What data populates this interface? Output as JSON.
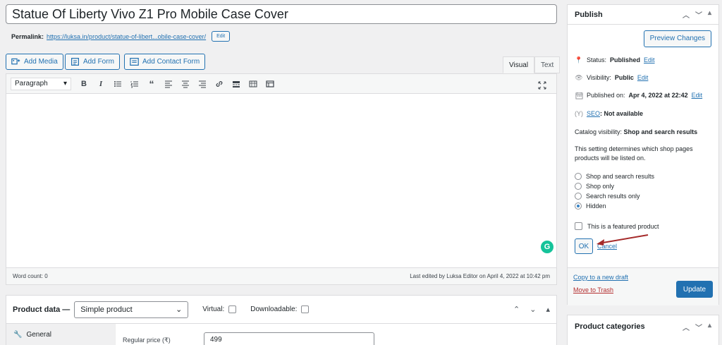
{
  "post": {
    "title": "Statue Of Liberty Vivo Z1 Pro Mobile Case Cover",
    "permalink_label": "Permalink:",
    "permalink_url": "https://luksa.in/product/statue-of-libert...obile-case-cover/",
    "permalink_edit": "Edit"
  },
  "media_buttons": {
    "add_media": "Add Media",
    "add_form": "Add Form",
    "add_contact_form": "Add Contact Form"
  },
  "editor_tabs": {
    "visual": "Visual",
    "text": "Text"
  },
  "editor_toolbar": {
    "format_select": "Paragraph",
    "icons": [
      "bold-icon",
      "italic-icon",
      "bullet-list-icon",
      "numbered-list-icon",
      "blockquote-icon",
      "align-left-icon",
      "align-center-icon",
      "align-right-icon",
      "link-icon",
      "read-more-icon",
      "toolbar-toggle-icon",
      "table-icon"
    ]
  },
  "editor_status": {
    "word_count": "Word count: 0",
    "last_edited": "Last edited by Luksa Editor on April 4, 2022 at 10:42 pm"
  },
  "product_data": {
    "title": "Product data —",
    "type_select": "Simple product",
    "virtual_label": "Virtual:",
    "downloadable_label": "Downloadable:",
    "tab_general": "General",
    "regular_price_label": "Regular price (₹)",
    "regular_price_value": "499"
  },
  "publish": {
    "title": "Publish",
    "preview_label": "Preview Changes",
    "status_label": "Status:",
    "status_value": "Published",
    "visibility_label": "Visibility:",
    "visibility_value": "Public",
    "published_on_label": "Published on:",
    "published_on_value": "Apr 4, 2022 at 22:42",
    "edit": "Edit",
    "seo_label": "SEO",
    "seo_value": ": Not available",
    "catalog_label": "Catalog visibility:",
    "catalog_value": "Shop and search results",
    "catalog_desc": "This setting determines which shop pages products will be listed on.",
    "options": [
      {
        "label": "Shop and search results",
        "selected": false
      },
      {
        "label": "Shop only",
        "selected": false
      },
      {
        "label": "Search results only",
        "selected": false
      },
      {
        "label": "Hidden",
        "selected": true
      }
    ],
    "featured_label": "This is a featured product",
    "ok_label": "OK",
    "cancel_label": "Cancel",
    "copy_draft": "Copy to a new draft",
    "move_trash": "Move to Trash",
    "update_label": "Update"
  },
  "product_categories": {
    "title": "Product categories"
  },
  "colors": {
    "accent": "#2271b1",
    "danger": "#b32d2e",
    "annotation_arrow": "#a52a2a"
  }
}
